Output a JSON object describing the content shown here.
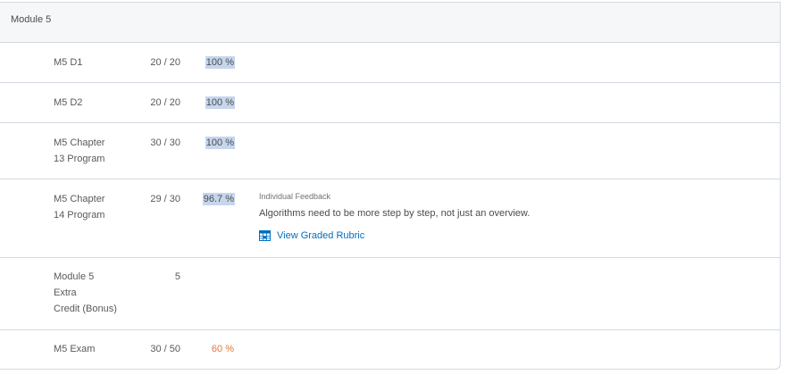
{
  "module": {
    "title": "Module 5"
  },
  "rows": [
    {
      "name": "M5 D1",
      "points": "20 / 20",
      "grade": "100 %"
    },
    {
      "name": "M5 D2",
      "points": "20 / 20",
      "grade": "100 %"
    },
    {
      "name": "M5 Chapter\n13 Program",
      "points": "30 / 30",
      "grade": "100 %"
    },
    {
      "name": "M5 Chapter\n14 Program",
      "points": "29 / 30",
      "grade": "96.7 %",
      "feedback_label": "Individual Feedback",
      "feedback_text": "Algorithms need to be more step by step, not just an overview.",
      "rubric_link": "View Graded Rubric"
    },
    {
      "name": "Module 5\nExtra\nCredit (Bonus)",
      "points": "5",
      "grade": ""
    },
    {
      "name": "M5 Exam",
      "points": "30 / 50",
      "grade": "60 %"
    }
  ],
  "colors": {
    "grade_highlight": "#c6d6ec",
    "warning_grade": "#e0783a",
    "link": "#006fbf",
    "header_bg": "#f6f7f8",
    "border": "#d3d9e3"
  },
  "icons": {
    "rubric": "rubric-grid-icon"
  }
}
